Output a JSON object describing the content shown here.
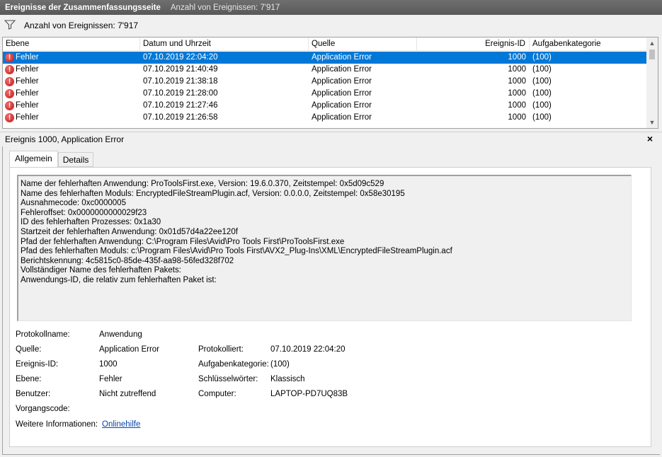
{
  "title_bar": {
    "title": "Ereignisse der Zusammenfassungsseite",
    "count_text": "Anzahl von Ereignissen: 7'917"
  },
  "filter_bar": {
    "icon": "filter-icon",
    "label": "Anzahl von Ereignissen: 7'917"
  },
  "event_list": {
    "columns": [
      "Ebene",
      "Datum und Uhrzeit",
      "Quelle",
      "Ereignis-ID",
      "Aufgabenkategorie"
    ],
    "rows": [
      {
        "level": "Fehler",
        "datetime": "07.10.2019 22:04:20",
        "source": "Application Error",
        "id": "1000",
        "category": "(100)",
        "selected": true
      },
      {
        "level": "Fehler",
        "datetime": "07.10.2019 21:40:49",
        "source": "Application Error",
        "id": "1000",
        "category": "(100)"
      },
      {
        "level": "Fehler",
        "datetime": "07.10.2019 21:38:18",
        "source": "Application Error",
        "id": "1000",
        "category": "(100)"
      },
      {
        "level": "Fehler",
        "datetime": "07.10.2019 21:28:00",
        "source": "Application Error",
        "id": "1000",
        "category": "(100)"
      },
      {
        "level": "Fehler",
        "datetime": "07.10.2019 21:27:46",
        "source": "Application Error",
        "id": "1000",
        "category": "(100)"
      },
      {
        "level": "Fehler",
        "datetime": "07.10.2019 21:26:58",
        "source": "Application Error",
        "id": "1000",
        "category": "(100)"
      }
    ]
  },
  "detail": {
    "header": "Ereignis 1000, Application Error",
    "close_label": "×",
    "tabs": [
      "Allgemein",
      "Details"
    ],
    "message_lines": [
      "Name der fehlerhaften Anwendung: ProToolsFirst.exe, Version: 19.6.0.370, Zeitstempel: 0x5d09c529",
      "Name des fehlerhaften Moduls: EncryptedFileStreamPlugin.acf, Version: 0.0.0.0, Zeitstempel: 0x58e30195",
      "Ausnahmecode: 0xc0000005",
      "Fehleroffset: 0x0000000000029f23",
      "ID des fehlerhaften Prozesses: 0x1a30",
      "Startzeit der fehlerhaften Anwendung: 0x01d57d4a22ee120f",
      "Pfad der fehlerhaften Anwendung: C:\\Program Files\\Avid\\Pro Tools First\\ProToolsFirst.exe",
      "Pfad des fehlerhaften Moduls: c:\\Program Files\\Avid\\Pro Tools First\\AVX2_Plug-Ins\\XML\\EncryptedFileStreamPlugin.acf",
      "Berichtskennung: 4c5815c0-85de-435f-aa98-56fed328f702",
      "Vollständiger Name des fehlerhaften Pakets:",
      "Anwendungs-ID, die relativ zum fehlerhaften Paket ist:"
    ],
    "props": {
      "protokollname_label": "Protokollname:",
      "protokollname": "Anwendung",
      "quelle_label": "Quelle:",
      "quelle": "Application Error",
      "protokolliert_label": "Protokolliert:",
      "protokolliert": "07.10.2019 22:04:20",
      "ereignis_id_label": "Ereignis-ID:",
      "ereignis_id": "1000",
      "aufgabenkategorie_label": "Aufgabenkategorie:",
      "aufgabenkategorie": "(100)",
      "ebene_label": "Ebene:",
      "ebene": "Fehler",
      "schluesselwoerter_label": "Schlüsselwörter:",
      "schluesselwoerter": "Klassisch",
      "benutzer_label": "Benutzer:",
      "benutzer": "Nicht zutreffend",
      "computer_label": "Computer:",
      "computer": "LAPTOP-PD7UQ83B",
      "vorgangscode_label": "Vorgangscode:",
      "weitere_label": "Weitere Informationen:",
      "weitere_link": "Onlinehilfe"
    }
  },
  "colors": {
    "selection": "#0078d7",
    "titlebar": "#646464",
    "error_icon": "#c01818",
    "link": "#0645ad"
  }
}
